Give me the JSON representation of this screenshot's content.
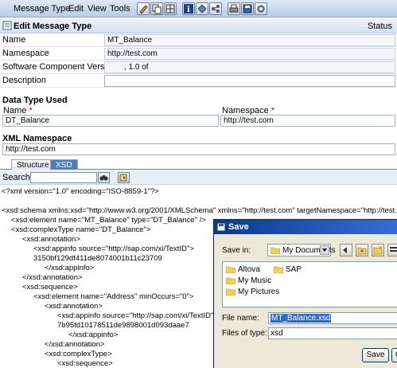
{
  "menu": {
    "message_type": "Message Type",
    "edit": "Edit",
    "view": "View",
    "tools": "Tools"
  },
  "header": {
    "title": "Edit Message Type",
    "status_label": "Status"
  },
  "form": {
    "name_label": "Name",
    "name_value": "MT_Balance",
    "namespace_label": "Namespace",
    "namespace_value": "http://test.com",
    "swc_label": "Software Component Version",
    "swc_value": ", 1.0 of",
    "description_label": "Description",
    "description_value": ""
  },
  "data_type": {
    "section_title": "Data Type Used",
    "name_label": "Name",
    "name_value": "DT_Balance",
    "namespace_label": "Namespace",
    "namespace_value": "http://test.com",
    "required_marker": "*"
  },
  "xml_namespace": {
    "section_title": "XML Namespace",
    "value": "http://test.com"
  },
  "tabs": [
    {
      "label": "Structure",
      "active": false
    },
    {
      "label": "XSD",
      "active": true
    }
  ],
  "search": {
    "label": "Search:",
    "value": ""
  },
  "xsd_lines": [
    "<?xml version=\"1.0\" encoding=\"ISO-8859-1\"?>",
    "",
    "<xsd:schema xmlns:xsd=\"http://www.w3.org/2001/XMLSchema\" xmlns=\"http://test.com\" targetNamespace=\"http://test.com\">",
    "<xsd:element name=\"MT_Balance\" type=\"DT_Balance\" />",
    "<xsd:complexType name=\"DT_Balance\">",
    "<xsd:annotation>",
    "<xsd:appinfo source=\"http://sap.com/xi/TextID\">",
    "3150bf129df411de8074001b11c23709",
    "</xsd:appinfo>",
    "</xsd:annotation>",
    "<xsd:sequence>",
    "<xsd:element name=\"Address\" minOccurs=\"0\">",
    "<xsd:annotation>",
    "<xsd:appinfo source=\"http://sap.com/xi/TextID\">",
    "7b95fd10178511de9898001d093daae7",
    "</xsd:appinfo>",
    "</xsd:annotation>",
    "<xsd:complexType>",
    "<xsd:sequence>"
  ],
  "save_dialog": {
    "title": "Save",
    "save_in_label": "Save in:",
    "save_in_value": "My Documents",
    "folders": [
      "Altova",
      "SAP",
      "My Music",
      "My Pictures"
    ],
    "file_name_label": "File name:",
    "file_name_value": "MT_Balance.xsd",
    "files_of_type_label": "Files of type:",
    "files_of_type_value": "xsd",
    "save_button": "Save",
    "cancel_button": "C"
  },
  "colors": {
    "menubar": "#b9cbe4",
    "active_tab": "#4e7cc1",
    "dialog_title": "#0a3a8c",
    "folder": "#f2cf5b"
  }
}
